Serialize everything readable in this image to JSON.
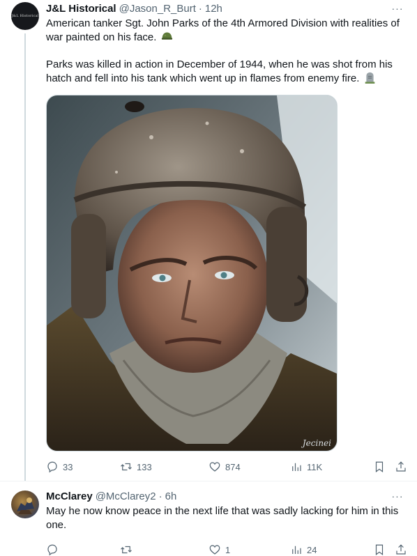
{
  "tweet": {
    "avatar_text": "J&L Historical",
    "name": "J&L Historical",
    "handle": "@Jason_R_Burt",
    "separator": "·",
    "time": "12h",
    "more": "···",
    "text_paragraph_1": "American tanker Sgt. John Parks of the 4th Armored Division with realities of war painted on his face.",
    "emoji_1": "military-helmet-emoji",
    "text_paragraph_2": "Parks was killed in action in December of 1944, when he was shot from his hatch and fell into his tank which went up in flames from enemy fire.",
    "emoji_2": "headstone-emoji",
    "image_signature": "Jecinei",
    "actions": {
      "replies": "33",
      "retweets": "133",
      "likes": "874",
      "views": "11K"
    }
  },
  "reply": {
    "name": "McClarey",
    "handle": "@McClarey2",
    "separator": "·",
    "time": "6h",
    "more": "···",
    "text": "May he now know peace in the next life that was sadly lacking for him in this one.",
    "actions": {
      "replies": "",
      "retweets": "",
      "likes": "1",
      "views": "24"
    }
  },
  "colors": {
    "text_primary": "#0f1419",
    "text_secondary": "#536471",
    "border": "#eff3f4",
    "thread_line": "#cfd9de"
  },
  "icons": [
    "reply-icon",
    "retweet-icon",
    "like-icon",
    "views-icon",
    "bookmark-icon",
    "share-icon",
    "more-icon"
  ]
}
